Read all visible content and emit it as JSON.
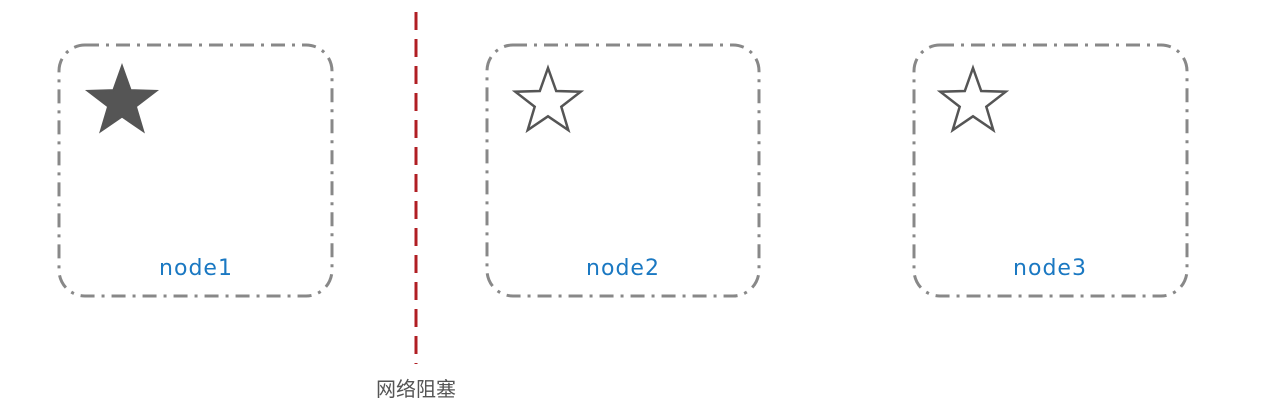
{
  "nodes": [
    {
      "label": "node1",
      "star": "filled"
    },
    {
      "label": "node2",
      "star": "outline"
    },
    {
      "label": "node3",
      "star": "outline"
    }
  ],
  "partition": {
    "label": "网络阻塞"
  },
  "colors": {
    "box_border": "#888888",
    "star": "#555555",
    "node_label": "#1a78c2",
    "partition_line": "#b01e23",
    "partition_label": "#555555"
  },
  "icons": {
    "filled_star": "star-filled-icon",
    "outline_star": "star-outline-icon"
  }
}
